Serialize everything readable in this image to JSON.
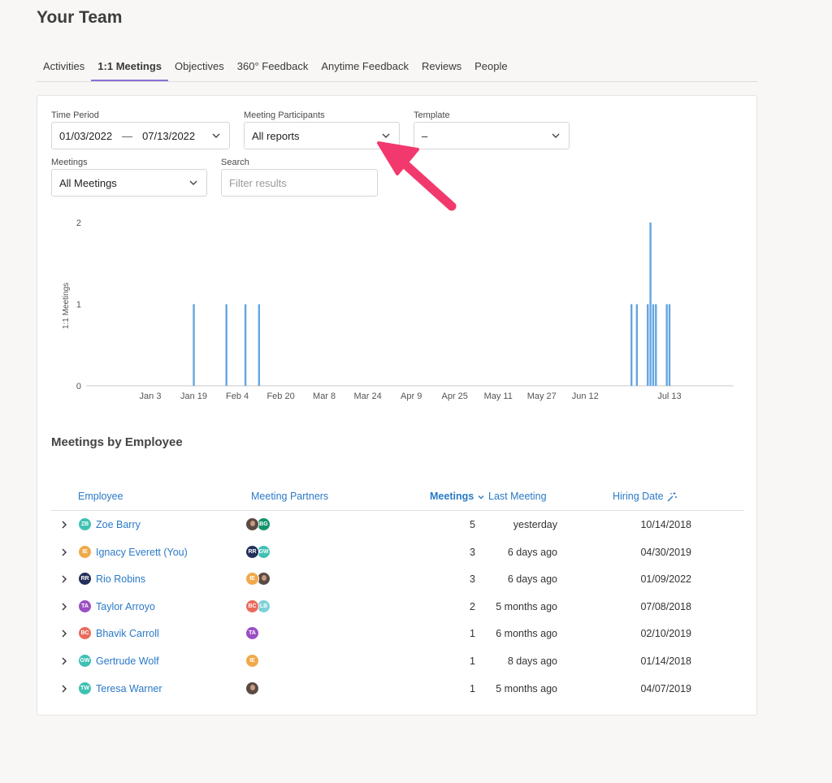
{
  "page_title": "Your Team",
  "tabs": [
    "Activities",
    "1:1 Meetings",
    "Objectives",
    "360° Feedback",
    "Anytime Feedback",
    "Reviews",
    "People"
  ],
  "active_tab": "1:1 Meetings",
  "filters": {
    "time_period": {
      "label": "Time Period",
      "start": "01/03/2022",
      "separator": "—",
      "end": "07/13/2022"
    },
    "participants": {
      "label": "Meeting Participants",
      "value": "All reports"
    },
    "template": {
      "label": "Template",
      "value": "–"
    },
    "meetings": {
      "label": "Meetings",
      "value": "All Meetings"
    },
    "search": {
      "label": "Search",
      "placeholder": "Filter results"
    }
  },
  "chart_data": {
    "type": "bar",
    "ylabel": "1:1 Meetings",
    "ylim": [
      0,
      2
    ],
    "yticks": [
      0,
      1,
      2
    ],
    "xticks": [
      "Jan 3",
      "Jan 19",
      "Feb 4",
      "Feb 20",
      "Mar 8",
      "Mar 24",
      "Apr 9",
      "Apr 25",
      "May 11",
      "May 27",
      "Jun 12",
      "Jul 13"
    ],
    "x": [
      "Jan 19",
      "Jan 31",
      "Feb 7",
      "Feb 12",
      "Jun 29",
      "Jul 1",
      "Jul 5",
      "Jul 6",
      "Jul 7",
      "Jul 8",
      "Jul 12",
      "Jul 13"
    ],
    "values": [
      1,
      1,
      1,
      1,
      1,
      1,
      1,
      2,
      1,
      1,
      1,
      1
    ],
    "color": "#63a6e0",
    "grid": false
  },
  "table": {
    "section_title": "Meetings by Employee",
    "headers": {
      "employee": "Employee",
      "partners": "Meeting Partners",
      "meetings": "Meetings",
      "last_meeting": "Last Meeting",
      "hiring_date": "Hiring Date"
    },
    "rows": [
      {
        "initials": "ZB",
        "color": "#3ec1b3",
        "name": "Zoe Barry",
        "partners": [
          {
            "initials": "",
            "photo": true
          },
          {
            "initials": "BG",
            "color": "#13936a"
          }
        ],
        "meetings": "5",
        "last": "yesterday",
        "hired": "10/14/2018"
      },
      {
        "initials": "IE",
        "color": "#f0a94a",
        "name": "Ignacy Everett (You)",
        "partners": [
          {
            "initials": "RR",
            "color": "#23305a"
          },
          {
            "initials": "GW",
            "color": "#3ec1b3"
          }
        ],
        "meetings": "3",
        "last": "6 days ago",
        "hired": "04/30/2019"
      },
      {
        "initials": "RR",
        "color": "#23305a",
        "name": "Rio Robins",
        "partners": [
          {
            "initials": "IE",
            "color": "#f0a94a"
          },
          {
            "initials": "",
            "photo": true
          }
        ],
        "meetings": "3",
        "last": "6 days ago",
        "hired": "01/09/2022"
      },
      {
        "initials": "TA",
        "color": "#9b4fc4",
        "name": "Taylor Arroyo",
        "partners": [
          {
            "initials": "BC",
            "color": "#ea6a5a"
          },
          {
            "initials": "LB",
            "color": "#7ed0d8"
          }
        ],
        "meetings": "2",
        "last": "5 months ago",
        "hired": "07/08/2018"
      },
      {
        "initials": "BC",
        "color": "#ea6a5a",
        "name": "Bhavik Carroll",
        "partners": [
          {
            "initials": "TA",
            "color": "#9b4fc4"
          }
        ],
        "meetings": "1",
        "last": "6 months ago",
        "hired": "02/10/2019"
      },
      {
        "initials": "GW",
        "color": "#3ec1b3",
        "name": "Gertrude Wolf",
        "partners": [
          {
            "initials": "IE",
            "color": "#f0a94a"
          }
        ],
        "meetings": "1",
        "last": "8 days ago",
        "hired": "01/14/2018"
      },
      {
        "initials": "TW",
        "color": "#3ec1b3",
        "name": "Teresa Warner",
        "partners": [
          {
            "initials": "",
            "photo": true
          }
        ],
        "meetings": "1",
        "last": "5 months ago",
        "hired": "04/07/2019"
      }
    ]
  },
  "accent_color": "#2a79c7",
  "annotation_color": "#f2396d"
}
